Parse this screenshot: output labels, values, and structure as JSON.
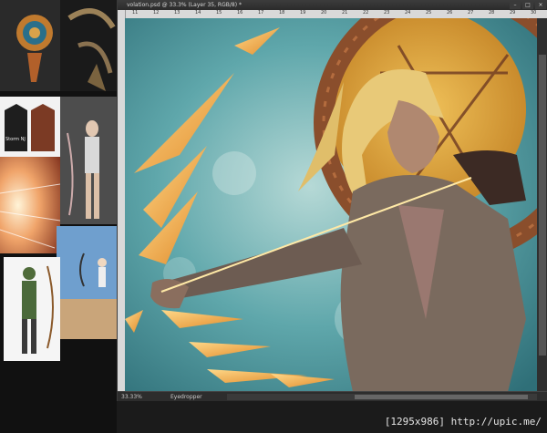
{
  "window": {
    "title": "volation.psd @ 33.3% (Layer 35, RGB/8) *",
    "controls": [
      "–",
      "□",
      "×"
    ]
  },
  "ruler": {
    "ticks": [
      "11",
      "12",
      "13",
      "14",
      "15",
      "16",
      "17",
      "18",
      "19",
      "20",
      "21",
      "22",
      "23",
      "24",
      "25",
      "26",
      "27",
      "28",
      "29",
      "30"
    ]
  },
  "status": {
    "zoom": "33.33%",
    "tool": "Eyedropper"
  },
  "reference_images": {
    "jacket_caption": "Storm NJ"
  },
  "watermark": "[1295x986] http://upic.me/"
}
